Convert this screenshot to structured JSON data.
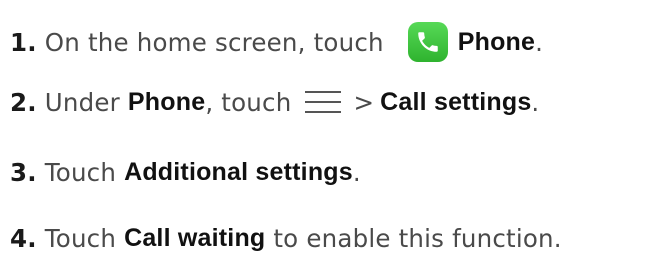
{
  "steps": [
    {
      "number": "1.",
      "text_before": "On the home screen, touch ",
      "icon": "phone-app-icon",
      "bold": "Phone",
      "text_after": "."
    },
    {
      "number": "2.",
      "text_before": "Under ",
      "bold": "Phone",
      "text_mid": ", touch",
      "icon": "menu-icon",
      "separator": ">",
      "bold2": "Call settings",
      "text_after": "."
    },
    {
      "number": "3.",
      "text_before": "Touch ",
      "bold": "Additional settings",
      "text_after": "."
    },
    {
      "number": "4.",
      "text_before": "Touch ",
      "bold": "Call waiting",
      "text_after": " to enable this function."
    }
  ],
  "colors": {
    "text": "#4a4a4a",
    "bold_text": "#111111",
    "phone_icon_bg": "#3cc43c",
    "menu_icon": "#555555"
  }
}
